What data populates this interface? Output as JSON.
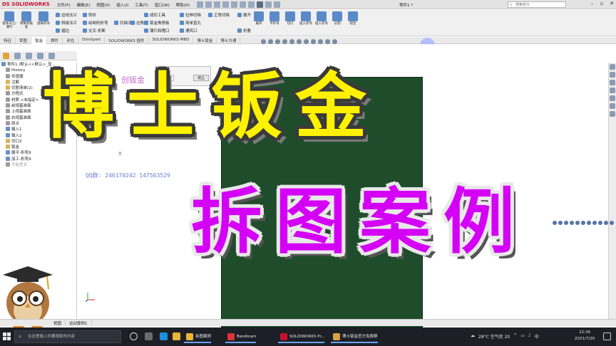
{
  "app": {
    "logo": "SOLIDWORKS",
    "doc_title": "零件1 *"
  },
  "menus": [
    "文件(F)",
    "编辑(E)",
    "视图(V)",
    "插入(I)",
    "工具(T)",
    "窗口(W)",
    "帮助(H)"
  ],
  "search": {
    "placeholder": "搜索命令"
  },
  "command_manager": {
    "big_buttons": [
      "基体法兰/薄片",
      "转换到钣金",
      "放样折弯",
      "插入折弯",
      "展开",
      "不折弯",
      "切口",
      "插入折弯",
      "分割",
      "组合"
    ],
    "small_buttons": [
      "边线法兰",
      "斜接法兰",
      "褶边",
      "转折",
      "绘制的折弯",
      "交叉-折断",
      "扫描法兰",
      "成形工具",
      "钣金角撑板",
      "薄片和槽口",
      "拉伸切除",
      "简单直孔",
      "通风口",
      "正常切除",
      "展开",
      "折叠",
      "边角"
    ]
  },
  "tabs": [
    "特征",
    "草图",
    "钣金",
    "焊件",
    "评估",
    "DimXpert",
    "SOLIDWORKS 插件",
    "SOLIDWORKS MBD",
    "博士钣金",
    "博士方通"
  ],
  "active_tab_index": 2,
  "tree": [
    {
      "label": "零件1 (默认<<默认>_显...",
      "icon": "b"
    },
    {
      "label": "History",
      "icon": "g"
    },
    {
      "label": "传感器",
      "icon": "g"
    },
    {
      "label": "注解",
      "icon": "y"
    },
    {
      "label": "切割清单(2)",
      "icon": "y"
    },
    {
      "label": "方程式",
      "icon": "g"
    },
    {
      "label": "材质 <未指定>",
      "icon": "g"
    },
    {
      "label": "前视基准面",
      "icon": "g"
    },
    {
      "label": "上视基准面",
      "icon": "g"
    },
    {
      "label": "右视基准面",
      "icon": "g"
    },
    {
      "label": "原点",
      "icon": "g"
    },
    {
      "label": "输入1",
      "icon": "b"
    },
    {
      "label": "输入2",
      "icon": "b"
    },
    {
      "label": "切口2",
      "icon": "y"
    },
    {
      "label": "钣金",
      "icon": "y"
    },
    {
      "label": "展平-折弯9",
      "icon": "b"
    },
    {
      "label": "加工-折弯9",
      "icon": "b"
    },
    {
      "label": "平板型式",
      "icon": "g",
      "dim": true
    }
  ],
  "graphics": {
    "faint_title": "创钣金",
    "qq_label": "QQ群: 246170242  147563529",
    "faint_x": "X",
    "popup": {
      "label": "揭立",
      "button": "揭立"
    }
  },
  "overlay": {
    "line1": "博士钣金",
    "line2": "拆图案例"
  },
  "sheet_tabs": [
    "视图",
    "运动算例1"
  ],
  "taskbar": {
    "search_placeholder": "在这里输入你要搜索的内容",
    "apps": [
      "拆图案例",
      "Bandicam",
      "SOLIDWORKS Pr...",
      "博士钣金官方免费群"
    ],
    "weather": "28°C 空气优 20",
    "time": "22:26",
    "date": "2021/7/20"
  },
  "colors": {
    "part_face": "#1f4d2b",
    "overlay_yellow": "#fff200",
    "overlay_purple": "#d400f5"
  }
}
